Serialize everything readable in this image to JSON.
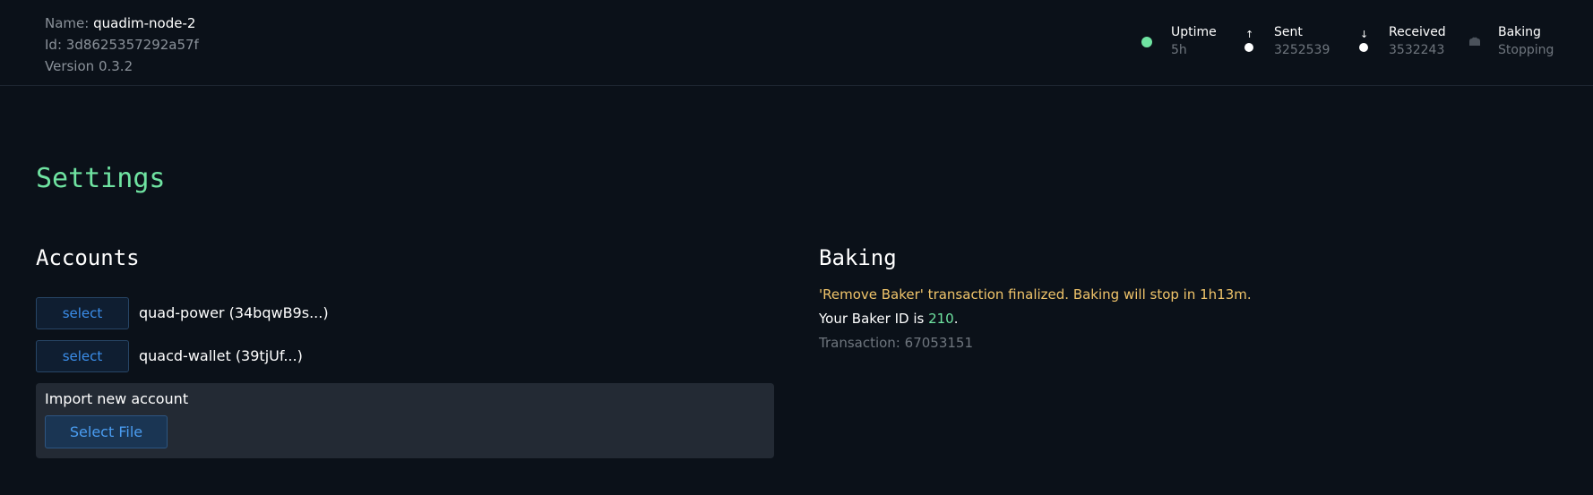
{
  "node": {
    "name_label": "Name:",
    "name": "quadim-node-2",
    "id_label": "Id:",
    "id": "3d8625357292a57f",
    "version_label": "Version",
    "version": "0.3.2"
  },
  "stats": {
    "uptime": {
      "label": "Uptime",
      "value": "5h",
      "dot_color": "#6fe3a1"
    },
    "sent": {
      "label": "Sent",
      "value": "3252539",
      "arrow": "↑"
    },
    "received": {
      "label": "Received",
      "value": "3532243",
      "arrow": "↓"
    },
    "baking": {
      "label": "Baking",
      "value": "Stopping"
    }
  },
  "page_title": "Settings",
  "accounts": {
    "heading": "Accounts",
    "items": [
      {
        "button": "select",
        "name": "quad-power (34bqwB9s...)"
      },
      {
        "button": "select",
        "name": "quacd-wallet (39tjUf...)"
      }
    ],
    "import_label": "Import new account",
    "import_button": "Select File"
  },
  "baking": {
    "heading": "Baking",
    "status_message": "'Remove Baker' transaction finalized. Baking will stop in 1h13m.",
    "baker_id_prefix": "Your Baker ID is",
    "baker_id": "210",
    "baker_id_suffix": ".",
    "transaction_label": "Transaction:",
    "transaction": "67053151"
  },
  "colors": {
    "background": "#0b1119",
    "accent_green": "#6fe3a1",
    "warning": "#f0c46a",
    "button_blue": "#3b8eea"
  }
}
